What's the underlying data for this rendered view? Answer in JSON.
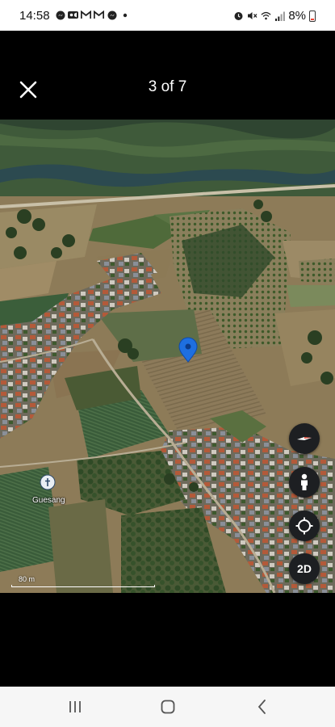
{
  "status_bar": {
    "time": "14:58",
    "battery": "8%",
    "left_icons": [
      "messenger-icon",
      "video-icon",
      "gmail-icon",
      "gmail-icon",
      "messenger-icon",
      "dot-icon"
    ],
    "right_icons": [
      "alarm-icon",
      "mute-icon",
      "wifi-icon",
      "signal-icon",
      "battery-icon"
    ]
  },
  "header": {
    "counter": "3 of 7"
  },
  "map": {
    "place_label": "Guesang",
    "scale_label": "80 m",
    "controls": {
      "compass": "compass-icon",
      "street_view": "pegman-icon",
      "my_location": "my-location-icon",
      "view_mode": "2D"
    },
    "colors": {
      "pin": "#1e6fe0",
      "control_bg": "#1d1f22"
    }
  },
  "nav_bar": {
    "icons": [
      "recent-apps-icon",
      "home-icon",
      "back-icon"
    ]
  }
}
